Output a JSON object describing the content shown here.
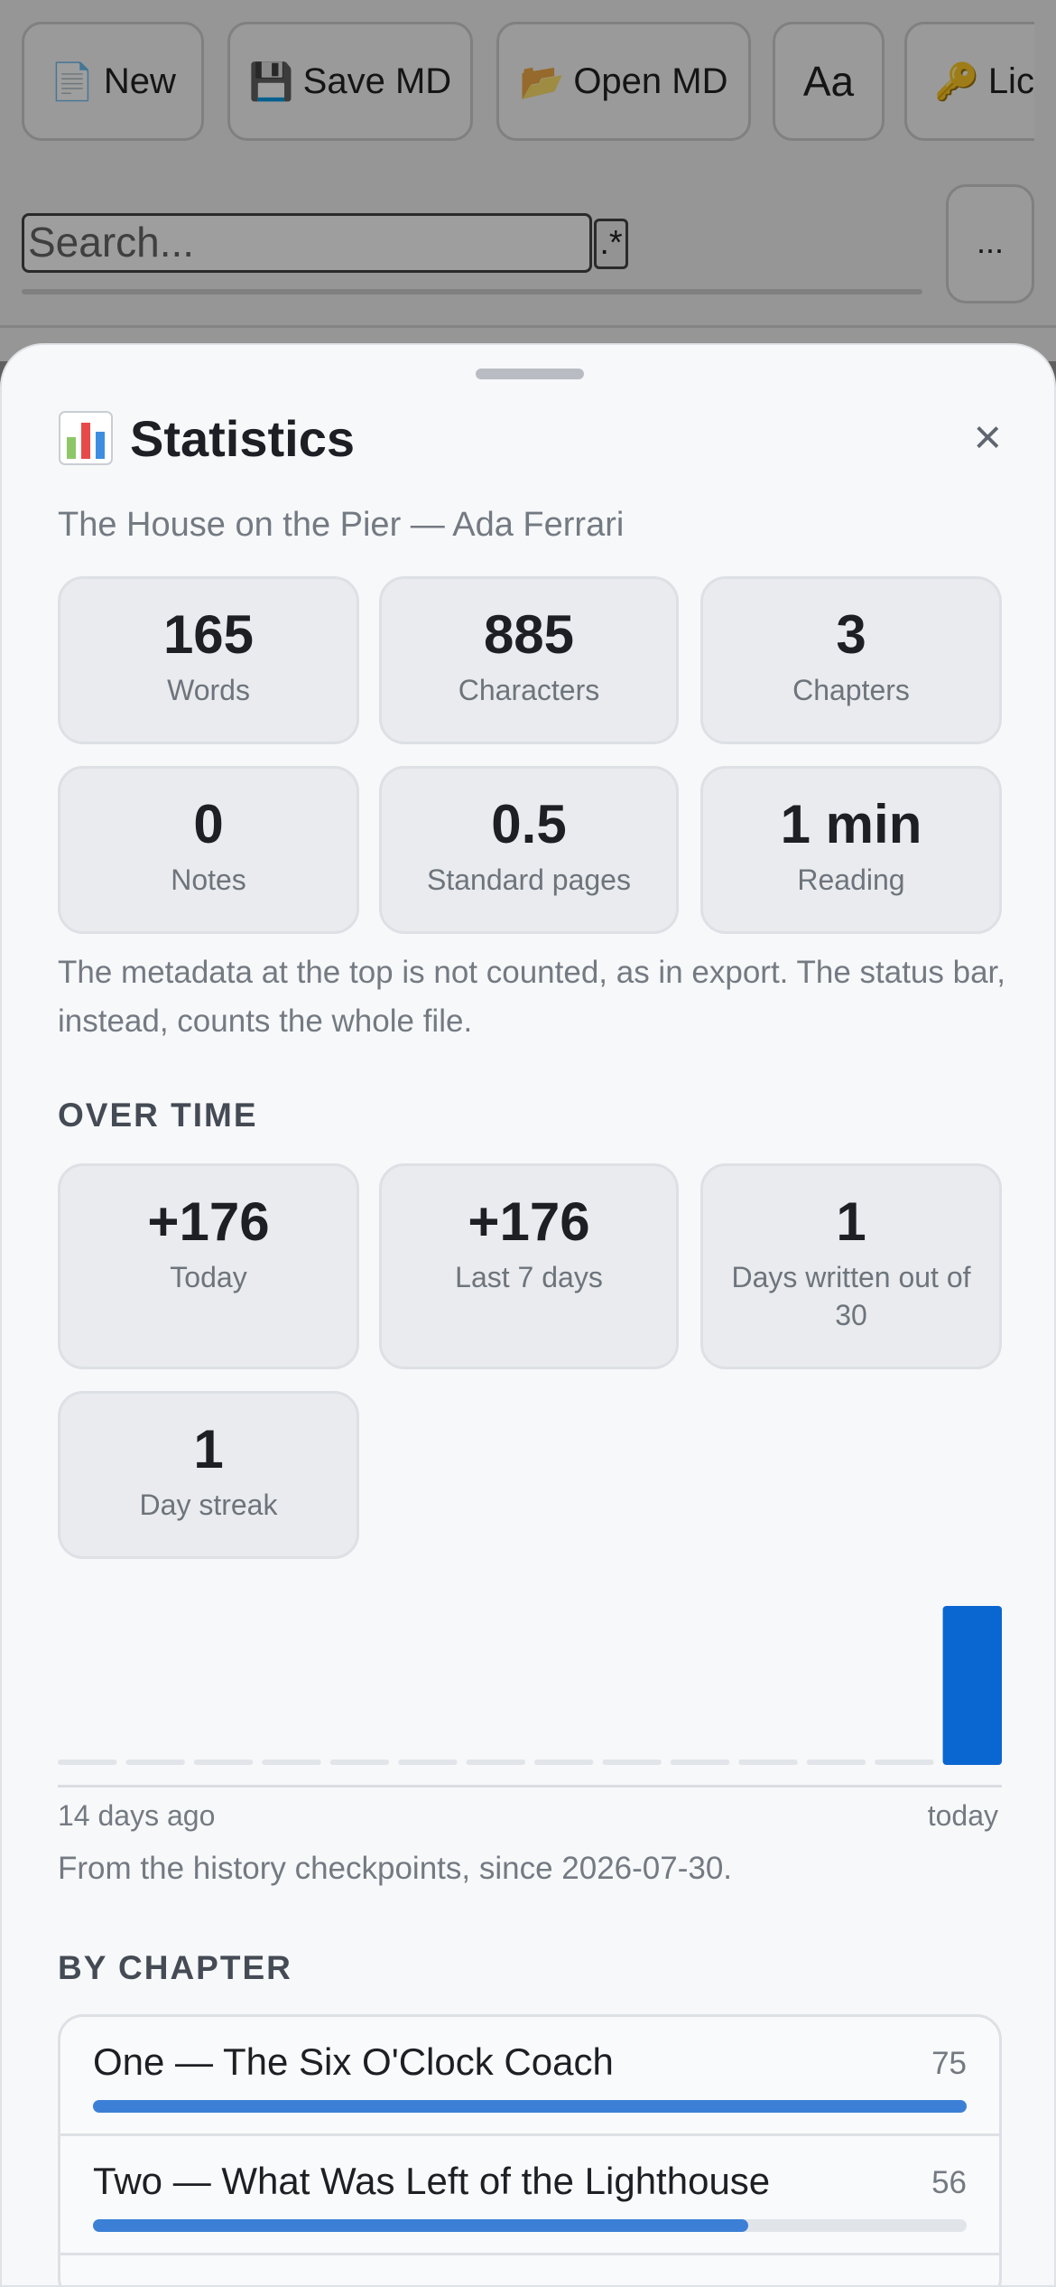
{
  "toolbar": {
    "buttons": [
      {
        "icon": "📄",
        "label": "New",
        "icon_name": "document-icon"
      },
      {
        "icon": "💾",
        "label": "Save MD",
        "icon_name": "floppy-disk-icon"
      },
      {
        "icon": "📂",
        "label": "Open MD",
        "icon_name": "open-folder-icon"
      },
      {
        "icon": "",
        "label": "Aa",
        "icon_name": "font-icon"
      },
      {
        "icon": "🔑",
        "label": "Lic",
        "icon_name": "key-icon"
      }
    ]
  },
  "search": {
    "placeholder": "Search...",
    "regex_label": ".*",
    "more_label": "..."
  },
  "sheet": {
    "title": "Statistics",
    "close_glyph": "×",
    "subtitle": "The House on the Pier — Ada Ferrari",
    "stats": [
      {
        "value": "165",
        "label": "Words"
      },
      {
        "value": "885",
        "label": "Characters"
      },
      {
        "value": "3",
        "label": "Chapters"
      },
      {
        "value": "0",
        "label": "Notes"
      },
      {
        "value": "0.5",
        "label": "Standard pages"
      },
      {
        "value": "1 min",
        "label": "Reading"
      }
    ],
    "metadata_note": "The metadata at the top is not counted, as in export. The status bar, instead, counts the whole file.",
    "over_time": {
      "heading": "OVER TIME",
      "stats": [
        {
          "value": "+176",
          "label": "Today"
        },
        {
          "value": "+176",
          "label": "Last 7 days"
        },
        {
          "value": "1",
          "label": "Days written out of 30"
        },
        {
          "value": "1",
          "label": "Day streak"
        }
      ],
      "axis_start": "14 days ago",
      "axis_end": "today",
      "history_note": "From the history checkpoints, since 2026-07-30."
    },
    "by_chapter": {
      "heading": "BY CHAPTER",
      "chapters": [
        {
          "title": "One — The Six O'Clock Coach",
          "count": "75",
          "fraction": 1.0
        },
        {
          "title": "Two — What Was Left of the Lighthouse",
          "count": "56",
          "fraction": 0.75
        }
      ]
    }
  },
  "chart_data": {
    "type": "bar",
    "categories": [
      "14 days ago",
      "",
      "",
      "",
      "",
      "",
      "",
      "",
      "",
      "",
      "",
      "",
      "",
      "today"
    ],
    "values": [
      0,
      0,
      0,
      0,
      0,
      0,
      0,
      0,
      0,
      0,
      0,
      0,
      0,
      176
    ],
    "colors": {
      "bar": "#0a66d1",
      "empty": "#e1e4e8"
    }
  }
}
